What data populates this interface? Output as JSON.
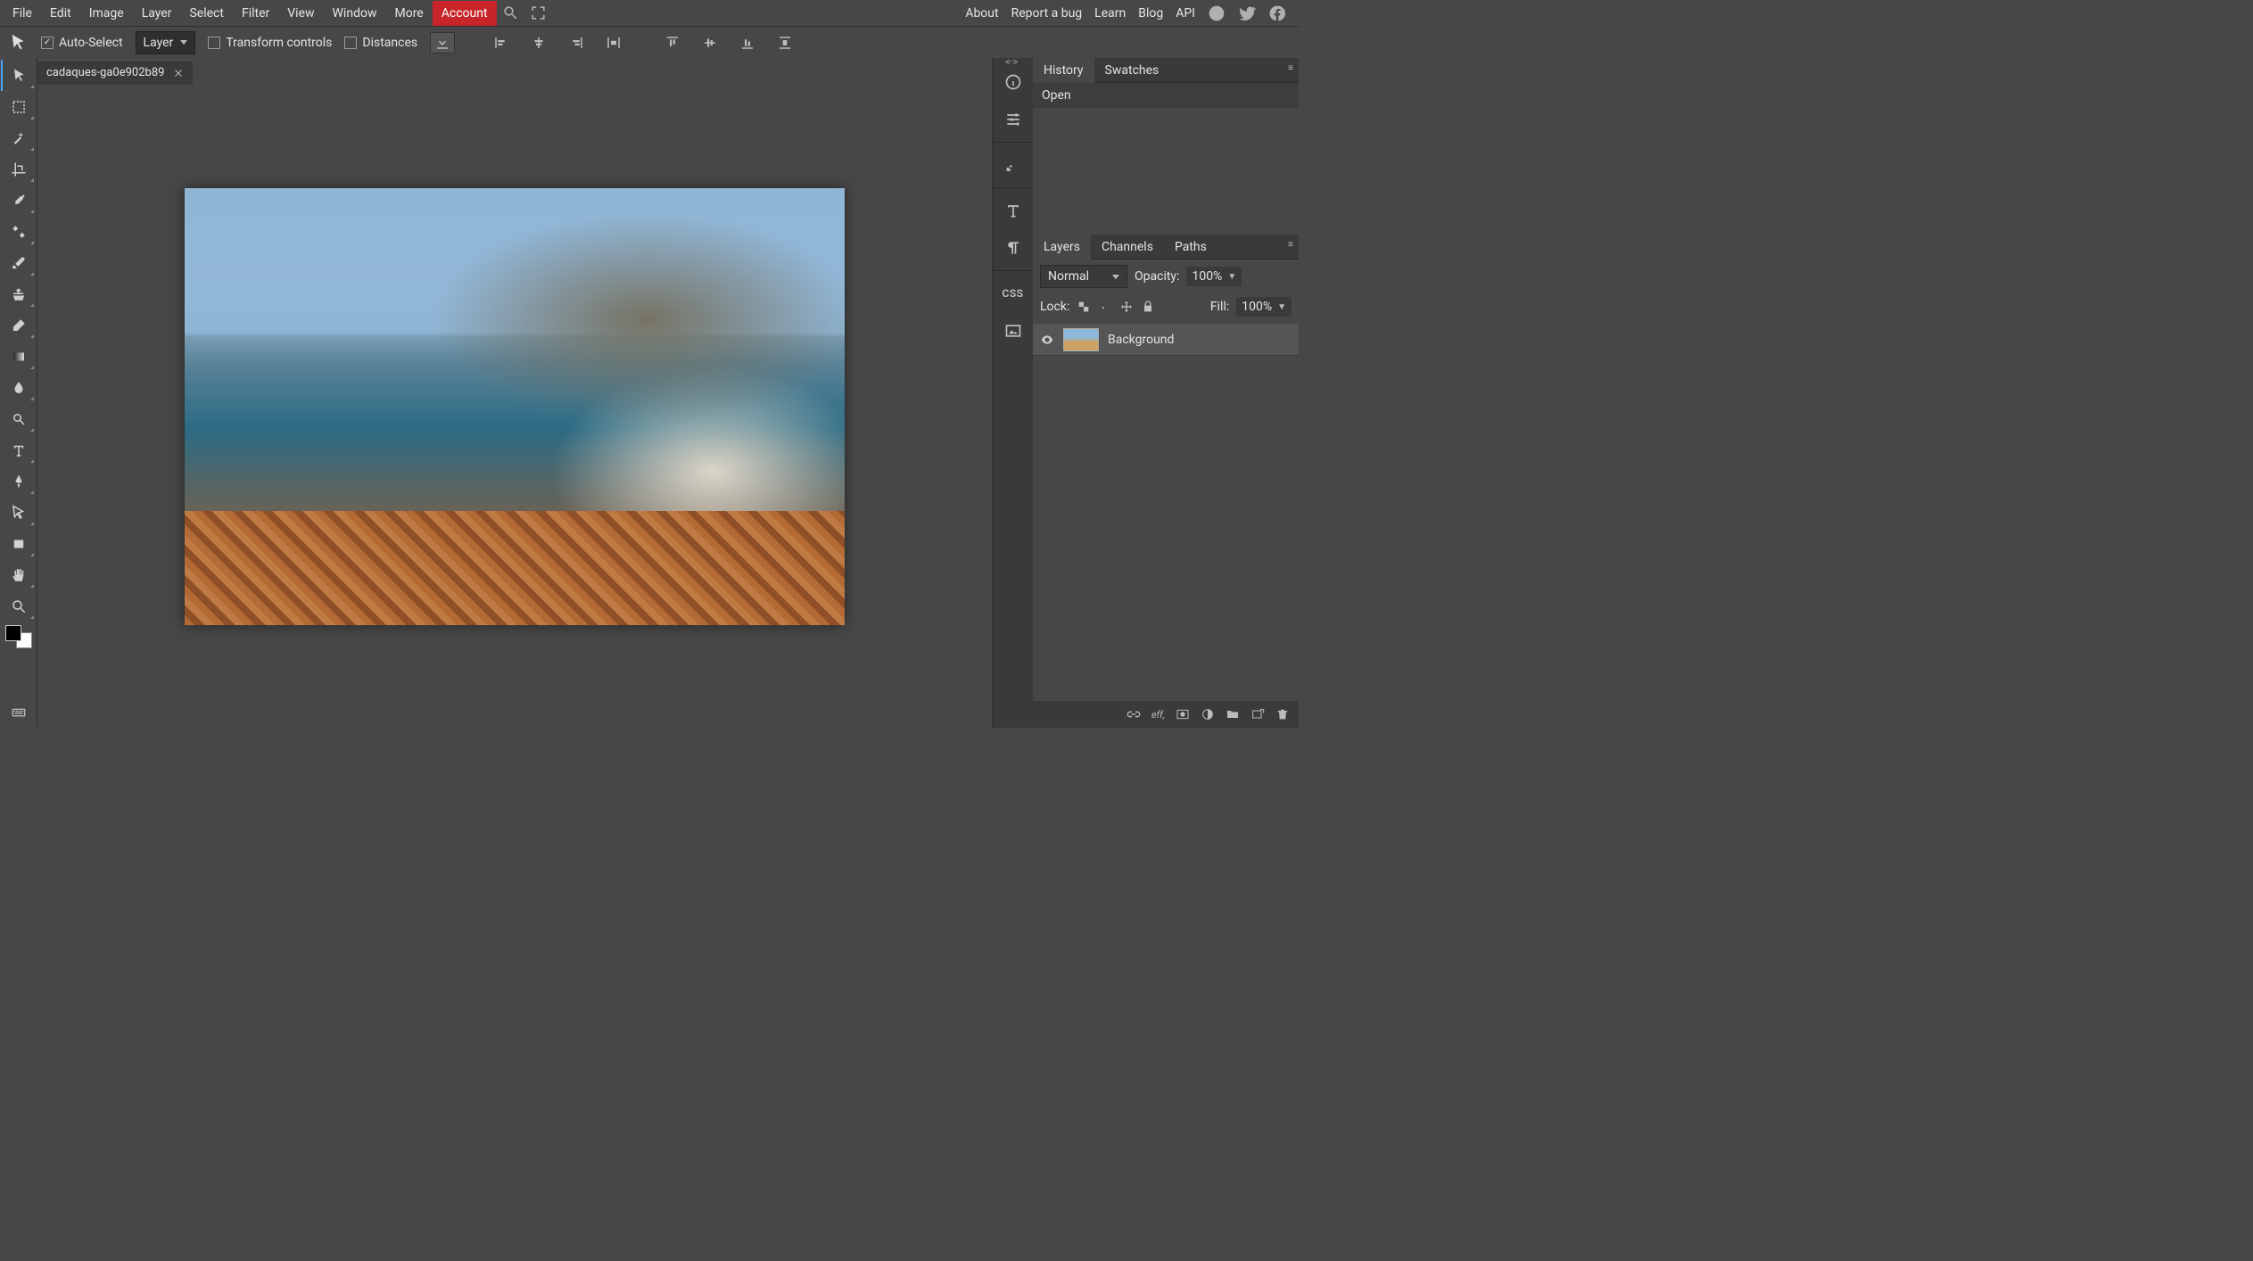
{
  "menubar": {
    "items": [
      "File",
      "Edit",
      "Image",
      "Layer",
      "Select",
      "Filter",
      "View",
      "Window",
      "More"
    ],
    "account": "Account",
    "right": [
      "About",
      "Report a bug",
      "Learn",
      "Blog",
      "API"
    ]
  },
  "optionsbar": {
    "auto_select": "Auto-Select",
    "layer_drop": "Layer",
    "transform": "Transform controls",
    "distances": "Distances"
  },
  "document": {
    "tab_name": "cadaques-ga0e902b89"
  },
  "toolbar_tools": [
    "move",
    "rect-select",
    "wand",
    "crop",
    "eyedropper",
    "heal",
    "brush",
    "stamp",
    "eraser",
    "gradient",
    "blur",
    "dodge",
    "type",
    "pen",
    "path-select",
    "shape",
    "hand",
    "zoom"
  ],
  "iconstrip": [
    "info",
    "sliders",
    "brush-preset",
    "character",
    "paragraph",
    "css",
    "image-preview"
  ],
  "history_panel": {
    "tabs": [
      "History",
      "Swatches"
    ],
    "items": [
      "Open"
    ]
  },
  "layers_panel": {
    "tabs": [
      "Layers",
      "Channels",
      "Paths"
    ],
    "blend_mode": "Normal",
    "opacity_label": "Opacity:",
    "opacity_value": "100%",
    "lock_label": "Lock:",
    "fill_label": "Fill:",
    "fill_value": "100%",
    "layers": [
      {
        "name": "Background",
        "visible": true
      }
    ],
    "footer_fx": "eff,"
  }
}
